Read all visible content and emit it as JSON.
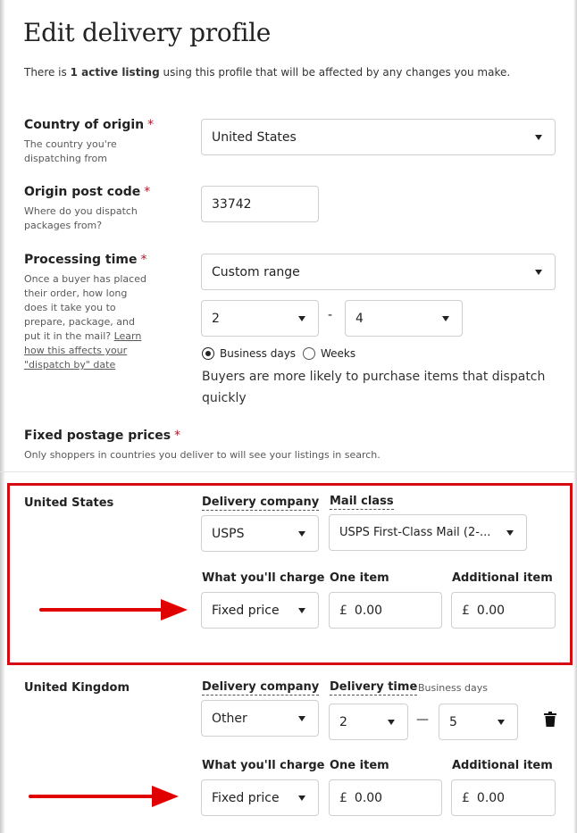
{
  "title": "Edit delivery profile",
  "intro": {
    "before": "There is ",
    "bold": "1 active listing",
    "after": " using this profile that will be affected by any changes you make."
  },
  "country_of_origin": {
    "label": "Country of origin",
    "required_mark": "*",
    "help": "The country you're dispatching from",
    "value": "United States"
  },
  "origin_post_code": {
    "label": "Origin post code",
    "required_mark": "*",
    "help": "Where do you dispatch packages from?",
    "value": "33742"
  },
  "processing_time": {
    "label": "Processing time",
    "required_mark": "*",
    "help_text": "Once a buyer has placed their order, how long does it take you to prepare, package, and put it in the mail?",
    "help_link": "Learn how this affects your \"dispatch by\" date",
    "range_select": "Custom range",
    "min": "2",
    "separator": "-",
    "max": "4",
    "unit_options": [
      {
        "label": "Business days",
        "selected": true
      },
      {
        "label": "Weeks",
        "selected": false
      }
    ],
    "note": "Buyers are more likely to purchase items that dispatch quickly"
  },
  "fixed_postage": {
    "label": "Fixed postage prices",
    "required_mark": "*",
    "help": "Only shoppers in countries you deliver to will see your listings in search."
  },
  "destinations": [
    {
      "country": "United States",
      "delivery_company_label": "Delivery company",
      "delivery_company": "USPS",
      "mail_class_label": "Mail class",
      "mail_class": "USPS First-Class Mail (2-...",
      "charge_label": "What you'll charge",
      "charge": "Fixed price",
      "one_item_label": "One item",
      "currency": "£",
      "one_item": "0.00",
      "additional_item_label": "Additional item",
      "additional_item": "0.00"
    },
    {
      "country": "United Kingdom",
      "delivery_company_label": "Delivery company",
      "delivery_company": "Other",
      "delivery_time_label": "Delivery time",
      "delivery_time_unit": "Business days",
      "delivery_time_min": "2",
      "delivery_time_separator": "—",
      "delivery_time_max": "5",
      "charge_label": "What you'll charge",
      "charge": "Fixed price",
      "one_item_label": "One item",
      "currency": "£",
      "one_item": "0.00",
      "additional_item_label": "Additional item",
      "additional_item": "0.00"
    }
  ],
  "colors": {
    "required": "#a61a2e",
    "annotation_red": "#d50a12",
    "border": "#cfcfcf"
  },
  "icons": [
    "caret-down-icon",
    "trash-icon",
    "annotation-arrow-icon"
  ]
}
